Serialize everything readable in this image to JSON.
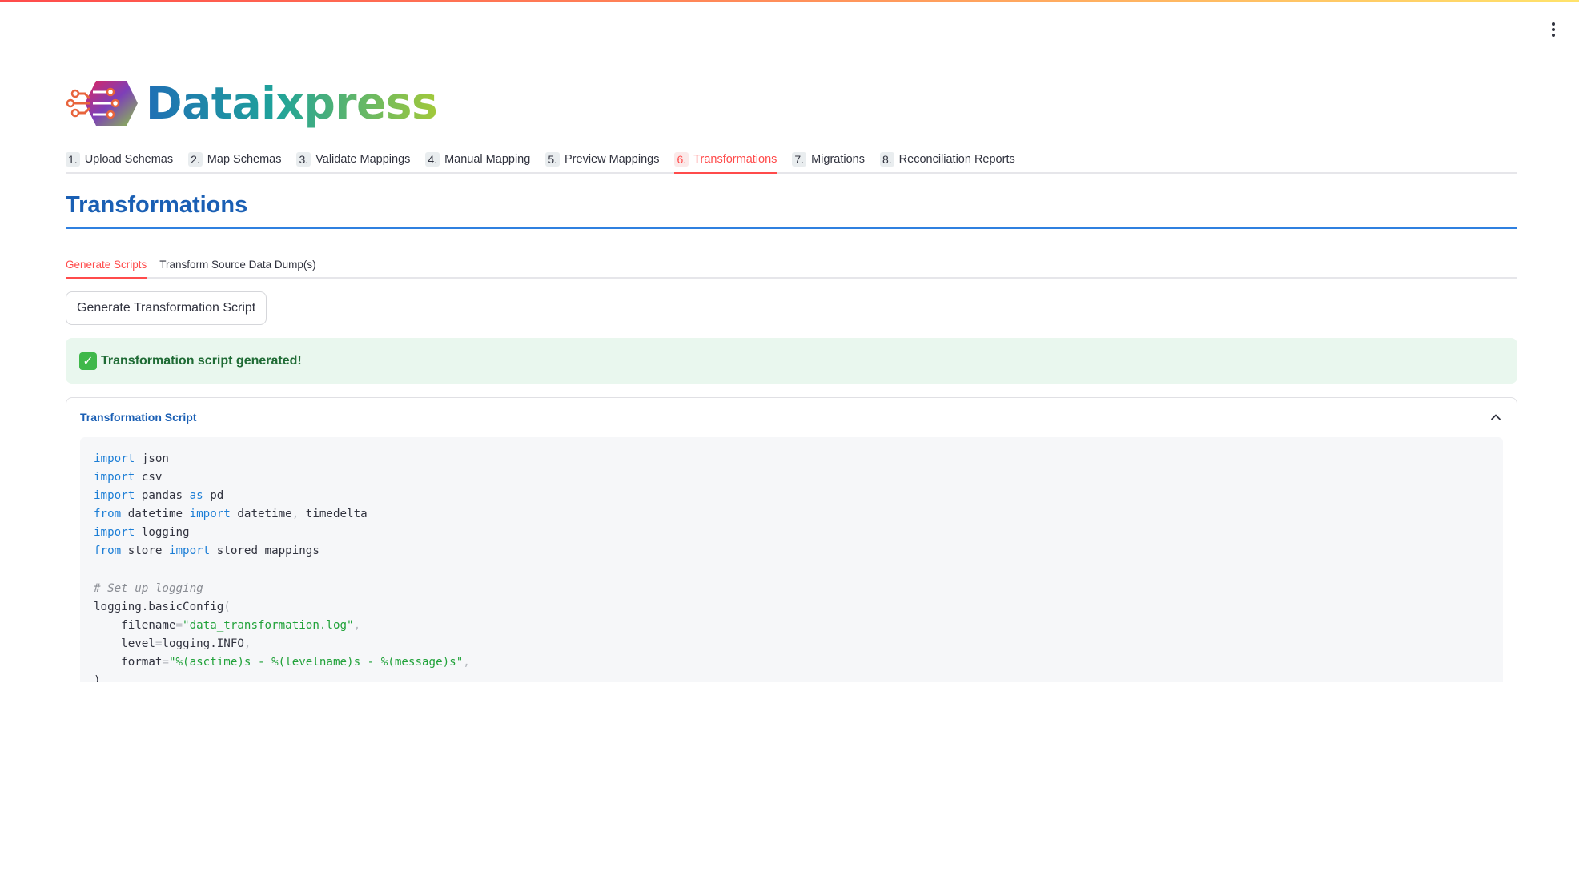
{
  "app": {
    "name": "Dataixpress"
  },
  "nav": {
    "tabs": [
      {
        "num": "1.",
        "label": "Upload Schemas"
      },
      {
        "num": "2.",
        "label": "Map Schemas"
      },
      {
        "num": "3.",
        "label": "Validate Mappings"
      },
      {
        "num": "4.",
        "label": "Manual Mapping"
      },
      {
        "num": "5.",
        "label": "Preview Mappings"
      },
      {
        "num": "6.",
        "label": "Transformations"
      },
      {
        "num": "7.",
        "label": "Migrations"
      },
      {
        "num": "8.",
        "label": "Reconciliation Reports"
      }
    ],
    "active_index": 5
  },
  "page": {
    "title": "Transformations"
  },
  "sub_tabs": {
    "items": [
      {
        "label": "Generate Scripts"
      },
      {
        "label": "Transform Source Data Dump(s)"
      }
    ],
    "active_index": 0
  },
  "actions": {
    "generate_button": "Generate Transformation Script"
  },
  "alert": {
    "icon": "check-icon",
    "text": "Transformation script generated!"
  },
  "expander": {
    "title": "Transformation Script",
    "icon": "chevron-up-icon",
    "code": {
      "line1": {
        "a": "import",
        "b": " json"
      },
      "line2": {
        "a": "import",
        "b": " csv"
      },
      "line3": {
        "a": "import",
        "b": " pandas ",
        "c": "as",
        "d": " pd"
      },
      "line4": {
        "a": "from",
        "b": " datetime ",
        "c": "import",
        "d": " datetime",
        "e": ",",
        "f": " timedelta"
      },
      "line5": {
        "a": "import",
        "b": " logging"
      },
      "line6": {
        "a": "from",
        "b": " store ",
        "c": "import",
        "d": " stored_mappings"
      },
      "line8": {
        "a": "# Set up logging"
      },
      "line9": {
        "a": "logging.basicConfig",
        "b": "("
      },
      "line10": {
        "a": "    filename",
        "b": "=",
        "c": "\"data_transformation.log\"",
        "d": ","
      },
      "line11": {
        "a": "    level",
        "b": "=",
        "c": "logging.INFO",
        "d": ","
      },
      "line12": {
        "a": "    format",
        "b": "=",
        "c": "\"%(asctime)s - %(levelname)s - %(message)s\"",
        "d": ","
      },
      "line13": {
        "a": ")"
      }
    }
  },
  "colors": {
    "accent": "#ff4b4b",
    "title_blue": "#1a5fb4",
    "success_bg": "#e9f7ee",
    "success_text": "#1f6b35",
    "code_keyword": "#1c7ed6",
    "code_string": "#21a23a"
  }
}
